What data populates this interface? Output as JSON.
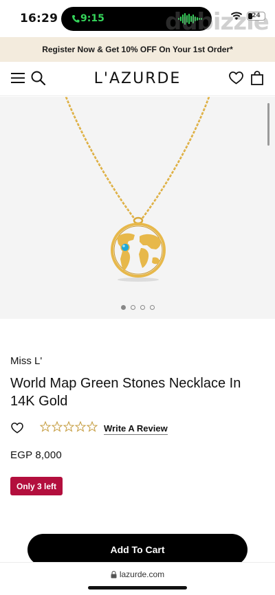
{
  "status_bar": {
    "time": "16:29",
    "call_time": "9:15",
    "battery": "24",
    "watermark": "dubizzle"
  },
  "promo_banner": {
    "text": "Register Now & Get 10% OFF On Your 1st Order*"
  },
  "header": {
    "logo": "L'AZURDE",
    "icons": [
      "menu-icon",
      "search-icon",
      "heart-icon",
      "shopping-bag-icon"
    ]
  },
  "gallery": {
    "image_count": 4,
    "active_index": 0
  },
  "product": {
    "brand": "Miss L'",
    "title": "World Map Green Stones Necklace In 14K Gold",
    "rating": 0,
    "rating_max": 5,
    "review_link": "Write A Review",
    "price": "EGP 8,000",
    "stock_badge": "Only 3 left"
  },
  "cart": {
    "button_label": "Add To Cart"
  },
  "browser": {
    "url": "lazurde.com"
  },
  "colors": {
    "promo_bg": "#f3ebdd",
    "badge": "#b30f3d",
    "star": "#c8a24a",
    "gold": "#e7b84a",
    "stone": "#1fa8d6",
    "call_green": "#35d45a"
  }
}
